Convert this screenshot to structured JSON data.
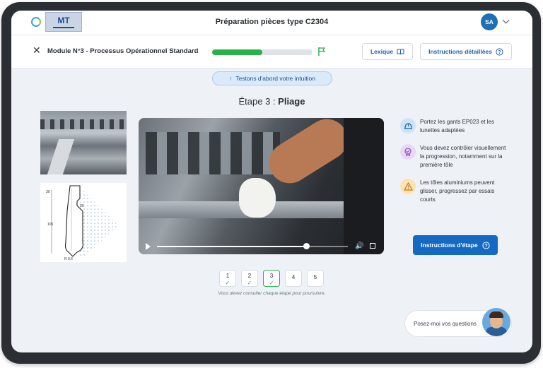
{
  "header": {
    "logo_text": "MT",
    "title": "Préparation pièces type C2304",
    "avatar_initials": "SA"
  },
  "module_bar": {
    "title": "Module N°3 - Processus Opérationnel Standard",
    "progress_fraction": 0.5,
    "lexique_label": "Lexique",
    "instructions_label": "Instructions détaillées"
  },
  "intuition_pill": "Testons d'abord votre intuition",
  "step": {
    "prefix": "Étape 3 : ",
    "name": "Pliage"
  },
  "video": {
    "played_fraction": 0.78
  },
  "drawing_labels": {
    "top": "30",
    "mid": "20",
    "height": "105",
    "bottom": "R 0,6"
  },
  "tips": [
    {
      "icon": "safety-helmet-icon",
      "text": "Portez les gants EP023 et les lunettes adaptées"
    },
    {
      "icon": "inspection-badge-icon",
      "text": "Vous devez contrôler visuellement la progression, notamment sur la première tôle"
    },
    {
      "icon": "warning-icon",
      "text": "Les tôles aluminiums peuvent glisser, progressez par essais courts"
    }
  ],
  "step_instructions_button": "Instructions d'étape",
  "steps": [
    {
      "label": "1",
      "status": "done"
    },
    {
      "label": "2",
      "status": "done"
    },
    {
      "label": "3",
      "status": "current"
    },
    {
      "label": "4",
      "status": "todo"
    },
    {
      "label": "5",
      "status": "todo"
    }
  ],
  "steps_note": "Vous devez consulter chaque étape pour poursuivre.",
  "assistant_prompt": "Posez-moi vos questions",
  "colors": {
    "primary": "#1469c2",
    "success": "#27b24a",
    "background": "#eef1f5"
  }
}
